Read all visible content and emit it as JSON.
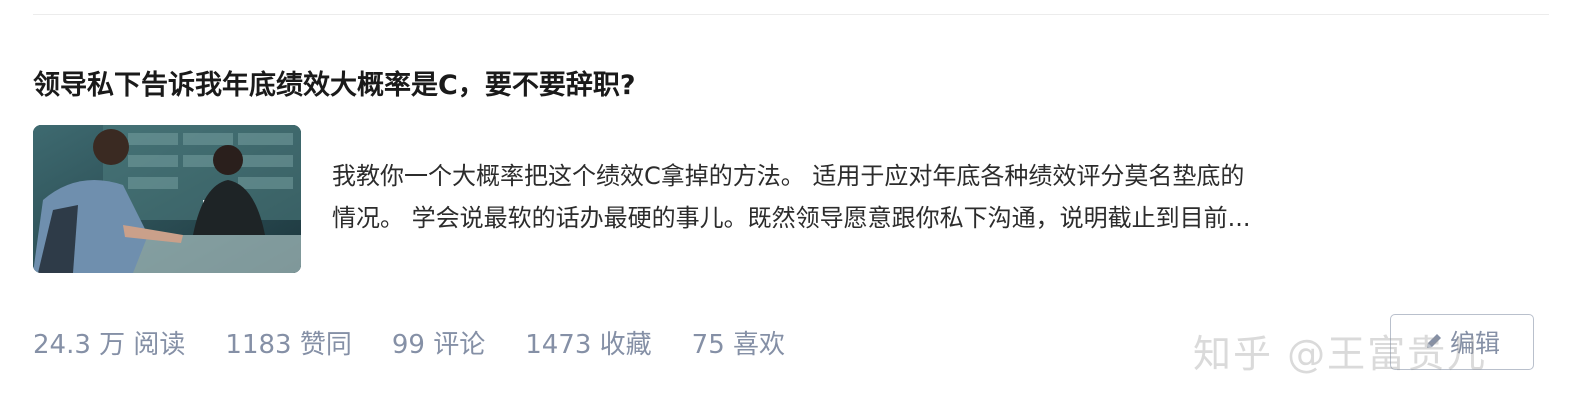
{
  "article": {
    "title": "领导私下告诉我年底绩效大概率是C，要不要辞职?",
    "excerpt_line1": "我教你一个大概率把这个绩效C拿掉的方法。 适用于应对年底各种绩效评分莫名垫底的",
    "excerpt_line2": "情况。 学会说最软的话办最硬的事儿。既然领导愿意跟你私下沟通，说明截止到目前..."
  },
  "stats": {
    "reads": "24.3 万 阅读",
    "likes": "1183 赞同",
    "comments": "99 评论",
    "favorites": "1473 收藏",
    "loves": "75 喜欢"
  },
  "edit_button": {
    "label": "编辑",
    "icon": "pencil-icon"
  },
  "watermark": "知乎 @王富贵儿",
  "colors": {
    "meta": "#8590a6",
    "title": "#1a1a1a",
    "text": "#2c2c2c"
  }
}
